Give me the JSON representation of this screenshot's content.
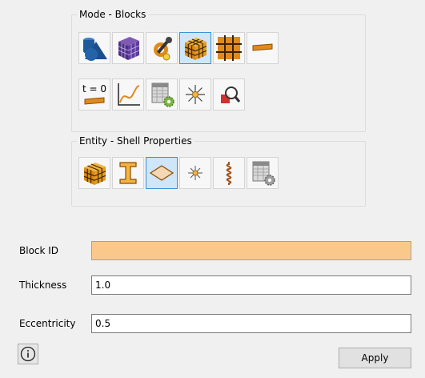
{
  "mode_group": {
    "title": "Mode - Blocks",
    "tools": [
      {
        "icon": "geometry-icon"
      },
      {
        "icon": "mesh-icon"
      },
      {
        "icon": "tools-icon"
      },
      {
        "icon": "blocks-icon",
        "active": true
      },
      {
        "icon": "grid-icon"
      },
      {
        "icon": "beam-icon"
      },
      {
        "icon": "initial-condition-icon",
        "text": "t = 0"
      },
      {
        "icon": "curve-icon"
      },
      {
        "icon": "table-settings-icon"
      },
      {
        "icon": "load-icon"
      },
      {
        "icon": "inspect-icon"
      }
    ]
  },
  "entity_group": {
    "title": "Entity - Shell Properties",
    "tools": [
      {
        "icon": "solid-icon"
      },
      {
        "icon": "beam-section-icon"
      },
      {
        "icon": "shell-icon",
        "active": true
      },
      {
        "icon": "point-icon"
      },
      {
        "icon": "spring-icon"
      },
      {
        "icon": "table-settings-icon"
      }
    ]
  },
  "form": {
    "block_id_label": "Block ID",
    "block_id_value": "",
    "thickness_label": "Thickness",
    "thickness_value": "1.0",
    "eccentricity_label": "Eccentricity",
    "eccentricity_value": "0.5"
  },
  "footer": {
    "info_icon": "info-icon",
    "apply_label": "Apply"
  },
  "colors": {
    "active_border": "#3d8fd6",
    "active_fill": "#cfe6f8",
    "block_id_fill": "#fbc88b",
    "orange": "#e08a1e",
    "blue": "#1e5a9c"
  }
}
